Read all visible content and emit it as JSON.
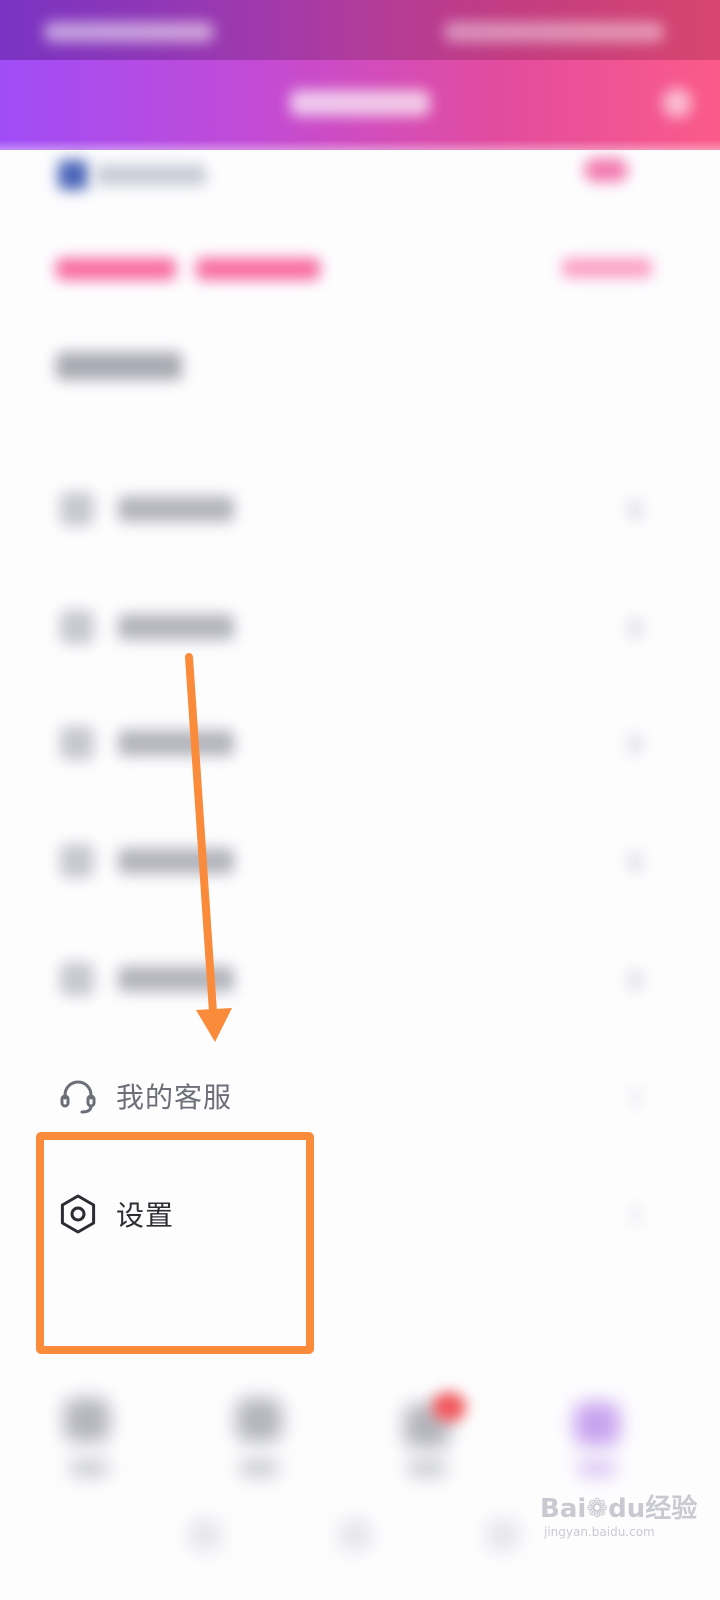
{
  "menu": {
    "customer_service": {
      "label": "我的客服",
      "icon": "headset-icon"
    },
    "settings": {
      "label": "设置",
      "icon": "gear-icon"
    }
  },
  "annotation": {
    "color": "#f98b3b"
  },
  "watermark": {
    "brand": "Bai",
    "brand_tail": "du",
    "suffix": "经验",
    "url": "jingyan.baidu.com"
  },
  "colors": {
    "header_gradient_start": "#a04df7",
    "header_gradient_end": "#fb5b8a",
    "accent_pink": "#f76b9f",
    "badge_red": "#f2575c"
  }
}
